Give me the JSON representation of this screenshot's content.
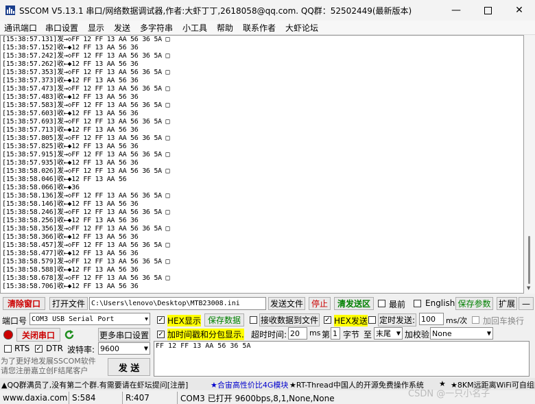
{
  "window": {
    "title": "SSCOM V5.13.1 串口/网络数据调试器,作者:大虾丁丁,2618058@qq.com. QQ群：52502449(最新版本)"
  },
  "menu": [
    "通讯端口",
    "串口设置",
    "显示",
    "发送",
    "多字符串",
    "小工具",
    "帮助",
    "联系作者",
    "大虾论坛"
  ],
  "log": [
    "[15:38:57.131]发→◇FF 12 FF 13 AA 56 36 5A □",
    "[15:38:57.152]收←◆12 FF 13 AA 56 36",
    "[15:38:57.242]发→◇FF 12 FF 13 AA 56 36 5A □",
    "[15:38:57.262]收←◆12 FF 13 AA 56 36",
    "[15:38:57.353]发→◇FF 12 FF 13 AA 56 36 5A □",
    "[15:38:57.373]收←◆12 FF 13 AA 56 36",
    "[15:38:57.473]发→◇FF 12 FF 13 AA 56 36 5A □",
    "[15:38:57.483]收←◆12 FF 13 AA 56 36",
    "[15:38:57.583]发→◇FF 12 FF 13 AA 56 36 5A □",
    "[15:38:57.603]收←◆12 FF 13 AA 56 36",
    "[15:38:57.693]发→◇FF 12 FF 13 AA 56 36 5A □",
    "[15:38:57.713]收←◆12 FF 13 AA 56 36",
    "[15:38:57.805]发→◇FF 12 FF 13 AA 56 36 5A □",
    "[15:38:57.825]收←◆12 FF 13 AA 56 36",
    "[15:38:57.915]发→◇FF 12 FF 13 AA 56 36 5A □",
    "[15:38:57.935]收←◆12 FF 13 AA 56 36",
    "[15:38:58.026]发→◇FF 12 FF 13 AA 56 36 5A □",
    "[15:38:58.046]收←◆12 FF 13 AA 56",
    "[15:38:58.066]收←◆36",
    "[15:38:58.136]发→◇FF 12 FF 13 AA 56 36 5A □",
    "[15:38:58.146]收←◆12 FF 13 AA 56 36",
    "[15:38:58.246]发→◇FF 12 FF 13 AA 56 36 5A □",
    "[15:38:58.256]收←◆12 FF 13 AA 56 36",
    "[15:38:58.356]发→◇FF 12 FF 13 AA 56 36 5A □",
    "[15:38:58.366]收←◆12 FF 13 AA 56 36",
    "[15:38:58.457]发→◇FF 12 FF 13 AA 56 36 5A □",
    "[15:38:58.477]收←◆12 FF 13 AA 56 36",
    "[15:38:58.579]发→◇FF 12 FF 13 AA 56 36 5A □",
    "[15:38:58.588]收←◆12 FF 13 AA 56 36",
    "[15:38:58.678]发→◇FF 12 FF 13 AA 56 36 5A □",
    "[15:38:58.706]收←◆12 FF 13 AA 56 36"
  ],
  "toolbar": {
    "clear_label": "清除窗口",
    "open_file_label": "打开文件",
    "file_path": "C:\\Users\\lenovo\\Desktop\\MTB23008.ini",
    "send_file_label": "发送文件",
    "stop_label": "停止",
    "clear_send_label": "清发送区",
    "topmost_label": "最前",
    "english_label": "English",
    "save_params_label": "保存参数",
    "expand_label": "扩展",
    "collapse_label": "—"
  },
  "port": {
    "port_label": "端口号",
    "port_value": "COM3 USB Serial Port",
    "close_port_label": "关闭串口",
    "more_settings_label": "更多串口设置",
    "rts_label": "RTS",
    "dtr_label": "DTR",
    "baud_label": "波特率:",
    "baud_value": "9600",
    "promo_line1": "为了更好地发展SSCOM软件",
    "promo_line2": "请您注册嘉立创F结尾客户",
    "send_label": "发  送"
  },
  "options": {
    "hex_display_label": "HEX显示",
    "save_data_label": "保存数据",
    "recv_to_file_label": "接收数据到文件",
    "hex_send_label": "HEX发送",
    "timed_send_label": "定时发送:",
    "interval_value": "100",
    "interval_unit": "ms/次",
    "append_crlf_label": "加回车换行",
    "timestamp_label": "加时间戳和分包显示.",
    "timeout_label": "超时时间:",
    "timeout_value": "20",
    "timeout_unit": "ms",
    "byte_prefix": "第",
    "byte_index": "1",
    "byte_label": "字节",
    "to_label": "至",
    "end_value": "末尾",
    "checksum_label": "加校验",
    "checksum_value": "None"
  },
  "send_text": "FF 12 FF 13 AA 56 36 5A",
  "ticker": {
    "part1": "▲QQ群满员了,没有第二个群.有需要请在虾坛提问[注册]",
    "part2": "★合宙高性价比4G模块",
    "part3": "★RT-Thread中国人的开源免费操作系统",
    "part4": "★",
    "part5": "★8KM远距离WiFi可自组网"
  },
  "status": {
    "website": "www.daxia.com",
    "sent": "S:584",
    "received": "R:407",
    "port_status": "COM3 已打开  9600bps,8,1,None,None",
    "watermark": "CSDN @一只小名子"
  }
}
